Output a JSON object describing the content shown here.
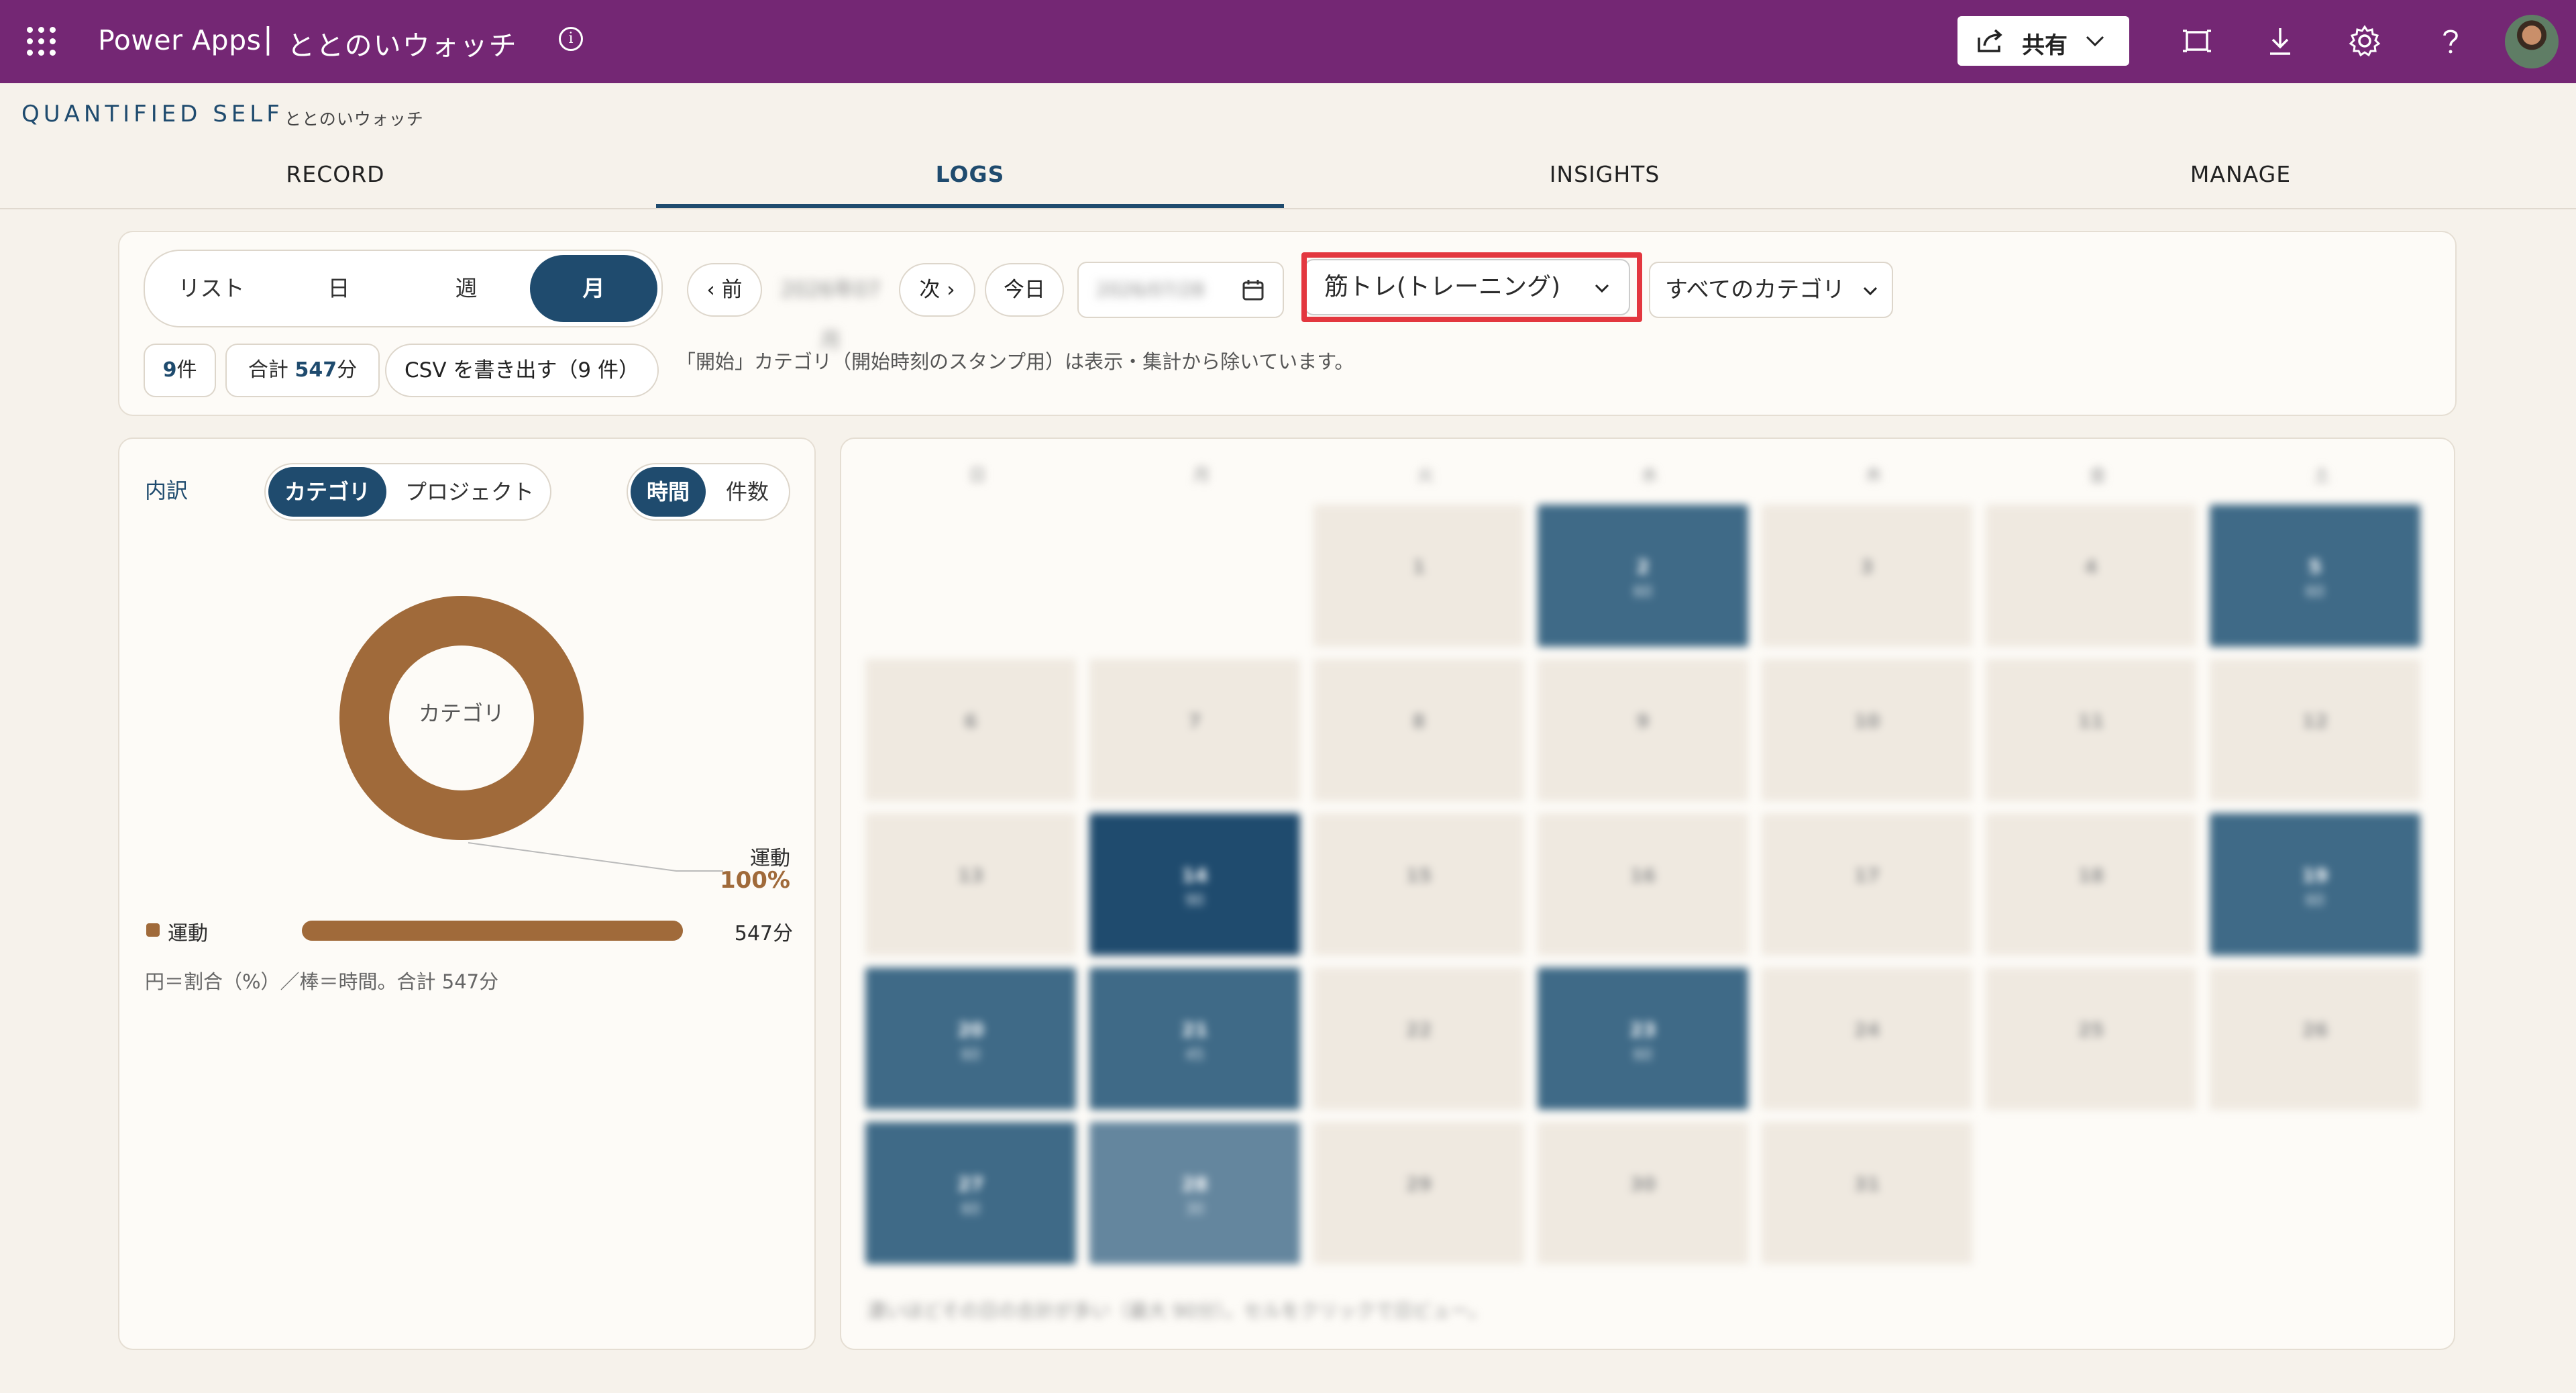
{
  "topbar": {
    "app": "Power Apps",
    "separator": "|",
    "title": "ととのいウォッチ",
    "share_label": "共有",
    "icons": [
      "waffle-icon",
      "info-icon",
      "share-icon",
      "fit-screen-icon",
      "download-icon",
      "gear-icon",
      "help-icon",
      "avatar"
    ]
  },
  "brand": {
    "name": "QUANTIFIED SELF",
    "subtitle": "ととのいウォッチ"
  },
  "tabs": [
    {
      "label": "RECORD",
      "active": false
    },
    {
      "label": "LOGS",
      "active": true
    },
    {
      "label": "INSIGHTS",
      "active": false
    },
    {
      "label": "MANAGE",
      "active": false
    }
  ],
  "toolbar": {
    "views": [
      "リスト",
      "日",
      "週",
      "月"
    ],
    "active_view": "月",
    "prev": "‹ 前",
    "current_period": "2026年07月",
    "next": "次 ›",
    "today": "今日",
    "date_value": "2026/07/28",
    "category_select": "筋トレ(トレーニング)",
    "all_categories": "すべてのカテゴリ",
    "count_num": "9",
    "count_unit": "件",
    "total_prefix": "合計",
    "total_num": "547",
    "total_unit": "分",
    "csv_label": "CSV を書き出す（9 件）",
    "note": "「開始」カテゴリ（開始時刻のスタンプ用）は表示・集計から除いています。"
  },
  "breakdown": {
    "title": "内訳",
    "group_toggle": [
      "カテゴリ",
      "プロジェクト"
    ],
    "metric_toggle": [
      "時間",
      "件数"
    ],
    "donut_center": "カテゴリ",
    "callout_label": "運動",
    "callout_pct": "100%",
    "share": 1.0,
    "legend": [
      {
        "label": "運動",
        "value": "547分",
        "ratio": 1.0,
        "color": "#a06a3a"
      }
    ],
    "footnote": "円＝割合（%）／棒＝時間。合計 547分"
  },
  "calendar": {
    "weekdays": [
      "日",
      "月",
      "火",
      "水",
      "木",
      "金",
      "土"
    ],
    "first_col": 2,
    "days_in_month": 31,
    "active_days": {
      "2": "60",
      "5": "60",
      "14": "90",
      "19": "60",
      "20": "60",
      "21": "45",
      "23": "60",
      "27": "60",
      "28": "30"
    },
    "darkest_day": "14",
    "lightest_day": "28",
    "hint": "濃いほどその日の合計が多い（最大 90分）。セルをクリックで日ビュー。"
  }
}
